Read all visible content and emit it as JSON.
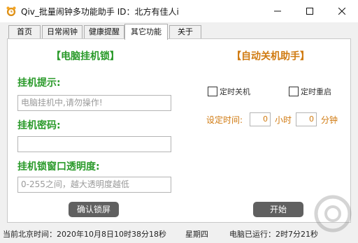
{
  "window": {
    "title": "Qiv_批量闹钟多功能助手    ID：北方有佳人i",
    "app_icon": "alarm-clock-icon",
    "controls": {
      "minimize": "minimize-icon",
      "maximize": "maximize-icon",
      "close": "close-icon"
    }
  },
  "tabs": [
    {
      "label": "首页",
      "active": false
    },
    {
      "label": "日常闹钟",
      "active": false
    },
    {
      "label": "健康提醒",
      "active": false
    },
    {
      "label": "其它功能",
      "active": true
    },
    {
      "label": "关于",
      "active": false
    }
  ],
  "lock": {
    "title": "【电脑挂机锁】",
    "hint_label": "挂机提示:",
    "hint_placeholder": "电脑挂机中,请勿操作!",
    "password_label": "挂机密码:",
    "password_value": "",
    "opacity_label": "挂机锁窗口透明度:",
    "opacity_placeholder": "0-255之间，越大透明度越低",
    "confirm_button": "确认锁屏"
  },
  "shutdown": {
    "title": "【自动关机助手】",
    "timed_shutdown": {
      "label": "定时关机",
      "checked": false
    },
    "timed_restart": {
      "label": "定时重启",
      "checked": false
    },
    "set_time_label": "设定时间:",
    "hours_value": "0",
    "hours_unit": "小时",
    "minutes_value": "0",
    "minutes_unit": "分钟",
    "start_button": "开始"
  },
  "status": {
    "beijing_time": "当前北京时间：2020年10月8日10时38分18秒",
    "weekday": "星期四",
    "uptime": "电脑已运行：2时7分21秒"
  },
  "colors": {
    "lock_green": "#2a9a2a",
    "shutdown_orange": "#d07a10",
    "button_gray": "#606060"
  }
}
